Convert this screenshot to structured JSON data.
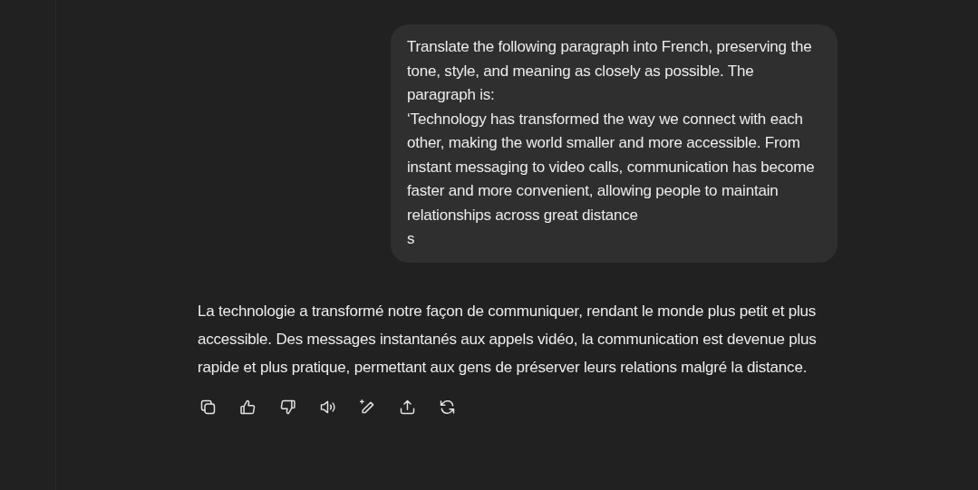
{
  "user_message": {
    "paragraphs": [
      "Translate the following paragraph into French, preserving the tone, style, and meaning as closely as possible. The paragraph is:",
      "‘Technology has transformed the way we connect with each other, making the world smaller and more accessible. From instant messaging to video calls, communication has become faster and more convenient, allowing people to maintain relationships across great distance",
      "s"
    ]
  },
  "assistant_message": {
    "text": "La technologie a transformé notre façon de communiquer, rendant le monde plus petit et plus accessible. Des messages instantanés aux appels vidéo, la communication est devenue plus rapide et plus pratique, permettant aux gens de préserver leurs relations malgré la distance.",
    "actions": [
      {
        "kind": "copy"
      },
      {
        "kind": "like"
      },
      {
        "kind": "dislike"
      },
      {
        "kind": "read_aloud"
      },
      {
        "kind": "edit"
      },
      {
        "kind": "share"
      },
      {
        "kind": "regenerate"
      }
    ]
  }
}
